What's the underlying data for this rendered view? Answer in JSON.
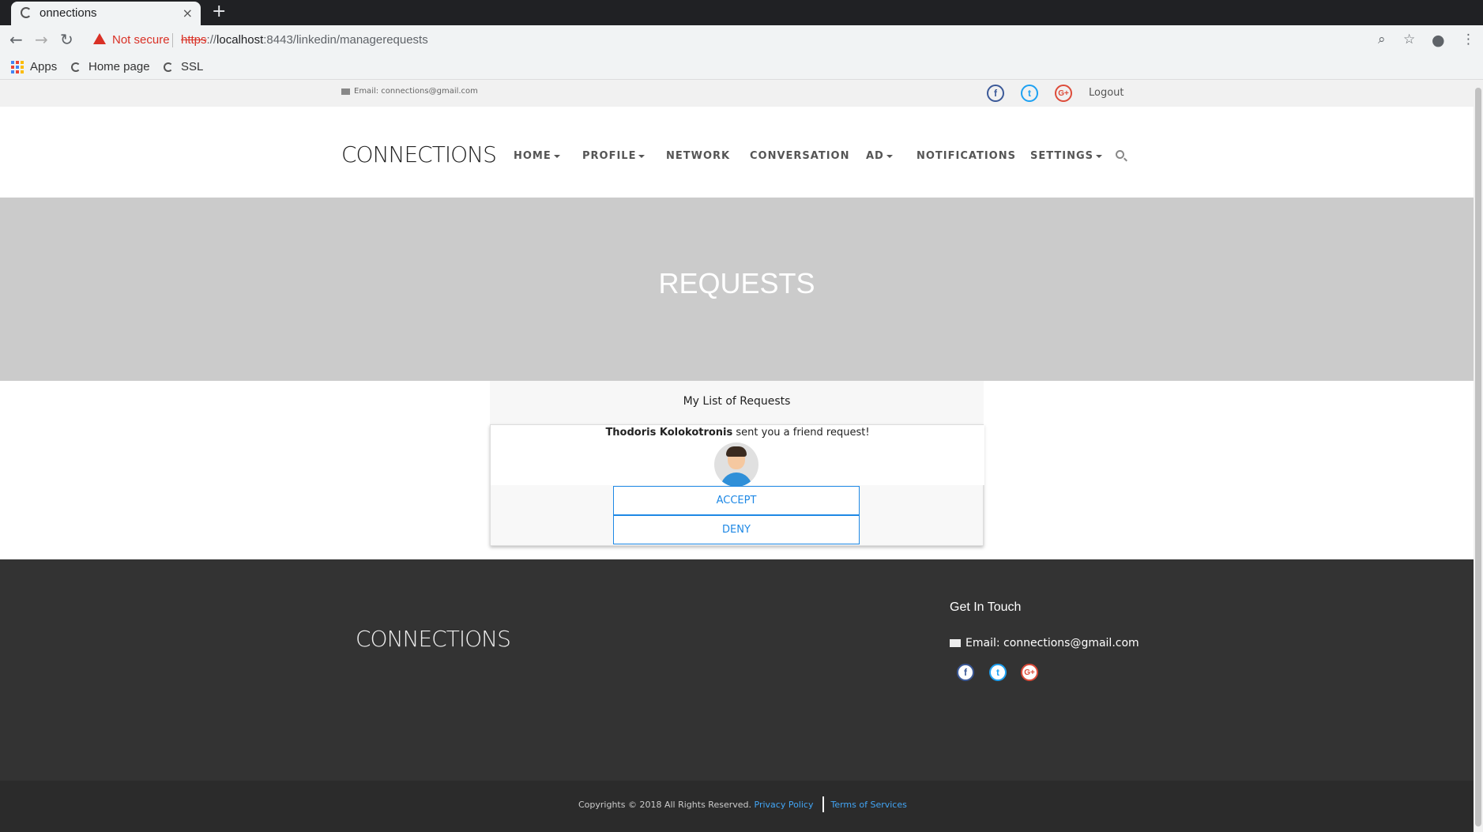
{
  "browser": {
    "tab_title": "onnections",
    "new_tab": "+",
    "close": "×",
    "security_label": "Not secure",
    "url_scheme": "https",
    "url_sep": "://",
    "url_host": "localhost",
    "url_rest": ":8443/linkedin/managerequests",
    "bookmarks": [
      "Apps",
      "Home page",
      "SSL"
    ]
  },
  "topbar": {
    "email": "Email: connections@gmail.com",
    "social": [
      "f",
      "t",
      "G+"
    ],
    "logout": "Logout"
  },
  "header": {
    "logo": "CONNECTIONS",
    "nav": [
      "HOME",
      "PROFILE",
      "NETWORK",
      "CONVERSATION",
      "AD",
      "NOTIFICATIONS",
      "SETTINGS"
    ]
  },
  "hero": {
    "title": "REQUESTS"
  },
  "requests": {
    "panel_title": "My List of Requests",
    "items": [
      {
        "name": "Thodoris Kolokotronis",
        "message": " sent you a friend request!",
        "accept": "ACCEPT",
        "deny": "DENY"
      }
    ]
  },
  "footer": {
    "logo": "CONNECTIONS",
    "get_in_touch": "Get In Touch",
    "email": "Email: connections@gmail.com",
    "social": [
      "f",
      "t",
      "G+"
    ],
    "copyright": "Copyrights © 2018 All Rights Reserved.",
    "privacy": "Privacy Policy",
    "terms": "Terms of Services"
  },
  "colors": {
    "accent": "#1e88e5",
    "hero": "#cbcbcb",
    "footer": "#333333"
  }
}
